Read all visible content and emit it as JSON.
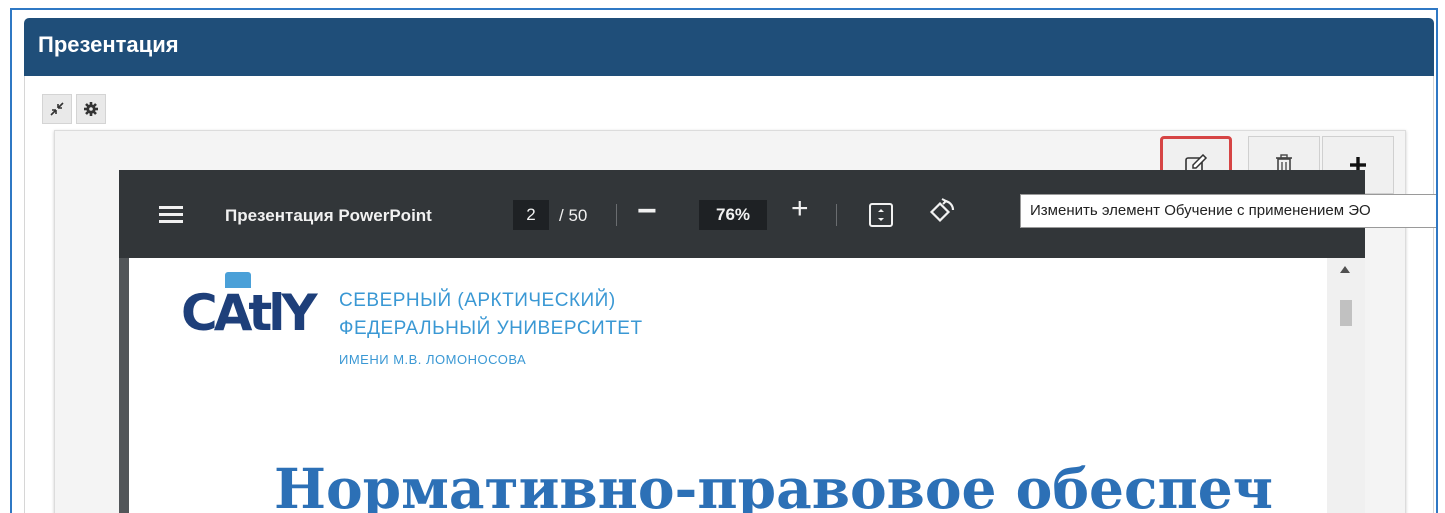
{
  "panel": {
    "title": "Презентация"
  },
  "toolbar": {
    "collapse_icon": "collapse-icon",
    "settings_icon": "gear-icon"
  },
  "actions": {
    "edit_icon": "edit-icon",
    "delete_icon": "trash-icon",
    "add_icon": "plus-icon",
    "add_label": "+"
  },
  "tooltip": {
    "text": "Изменить элемент Обучение с применением ЭО"
  },
  "viewer": {
    "doc_title": "Презентация PowerPoint",
    "current_page": "2",
    "total_pages": "/ 50",
    "zoom": "76%",
    "zoom_out_label": "−",
    "zoom_in_label": "+"
  },
  "slide": {
    "logo_text": "CAtlY",
    "university_line1": "СЕВЕРНЫЙ (АРКТИЧЕСКИЙ)",
    "university_line2": "ФЕДЕРАЛЬНЫЙ УНИВЕРСИТЕТ",
    "university_line3": "ИМЕНИ М.В. ЛОМОНОСОВА",
    "heading": "Нормативно-правовое обеспеч"
  },
  "colors": {
    "header": "#1f4e79",
    "highlight": "#d64545",
    "accent": "#2c70b6"
  }
}
